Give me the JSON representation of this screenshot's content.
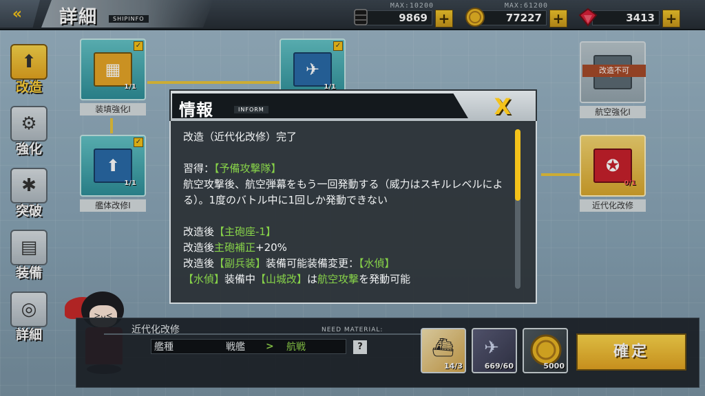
{
  "header": {
    "back_icon": "double-chevron-left-icon",
    "title": "詳細",
    "subtitle": "SHIPINFO"
  },
  "resources": [
    {
      "name": "oil",
      "max_label": "MAX:10200",
      "value": "9869",
      "icon": "oil-barrel-icon",
      "plus": "+"
    },
    {
      "name": "coin",
      "max_label": "MAX:61200",
      "value": "77227",
      "icon": "gold-coin-icon",
      "plus": "+"
    },
    {
      "name": "gem",
      "max_label": "",
      "value": "3413",
      "icon": "red-gem-icon",
      "plus": "+"
    }
  ],
  "sidebar": {
    "items": [
      {
        "label": "改造",
        "icon": "upgrade-arrow-icon",
        "active": true
      },
      {
        "label": "強化",
        "icon": "gear-clock-icon",
        "active": false
      },
      {
        "label": "突破",
        "icon": "gear-break-icon",
        "active": false
      },
      {
        "label": "装備",
        "icon": "equipment-icon",
        "active": false
      },
      {
        "label": "詳細",
        "icon": "detail-target-icon",
        "active": false
      }
    ]
  },
  "nodes": {
    "n1": {
      "label": "装填強化Ⅰ",
      "count": "1/1"
    },
    "n2": {
      "label": "艦体改修Ⅰ",
      "count": "1/1"
    },
    "n3": {
      "count": "1/1"
    },
    "n4": {
      "label": "航空強化Ⅰ",
      "tag": "改造不可"
    },
    "n5": {
      "label": "近代化改修",
      "count": "0/1"
    }
  },
  "modal": {
    "title": "情報",
    "subtitle": "INFORM",
    "close": "X",
    "lines": {
      "l1": "改造（近代化改修）完了",
      "l2a": "習得：",
      "l2b": "【予備攻撃隊】",
      "l3": "航空攻撃後、航空弾幕をもう一回発動する（威力はスキルレベルによる）。1度のバトル中に1回しか発動できない",
      "l4a": "改造後",
      "l4b": "【主砲座-1】",
      "l5a": "改造後",
      "l5b": "主砲補正",
      "l5c": "+20%",
      "l6a": "改造後",
      "l6b": "【副兵装】",
      "l6c": "装備可能装備変更：",
      "l6d": "【水偵】",
      "l7a": "【水偵】",
      "l7b": "装備中",
      "l7c": "【山城改】",
      "l7d": "は",
      "l7e": "航空攻撃",
      "l7f": "を発動可能"
    }
  },
  "bottom": {
    "title": "近代化改修",
    "need_material": "NEED MATERIAL:",
    "row_label": "艦種",
    "from": "戦艦",
    "arrow": ">",
    "to": "航戦",
    "help": "?",
    "materials": [
      {
        "name": "ship-material",
        "count": "14/3",
        "icon": "ship-icon"
      },
      {
        "name": "blueprint-material",
        "count": "669/60",
        "icon": "blueprint-icon"
      },
      {
        "name": "coin-material",
        "count": "5000",
        "icon": "gold-coin-icon"
      }
    ],
    "confirm": "確定"
  },
  "colors": {
    "accent_gold": "#f4c21a",
    "highlight_green": "#87d349",
    "panel_dark": "#2d3338"
  }
}
